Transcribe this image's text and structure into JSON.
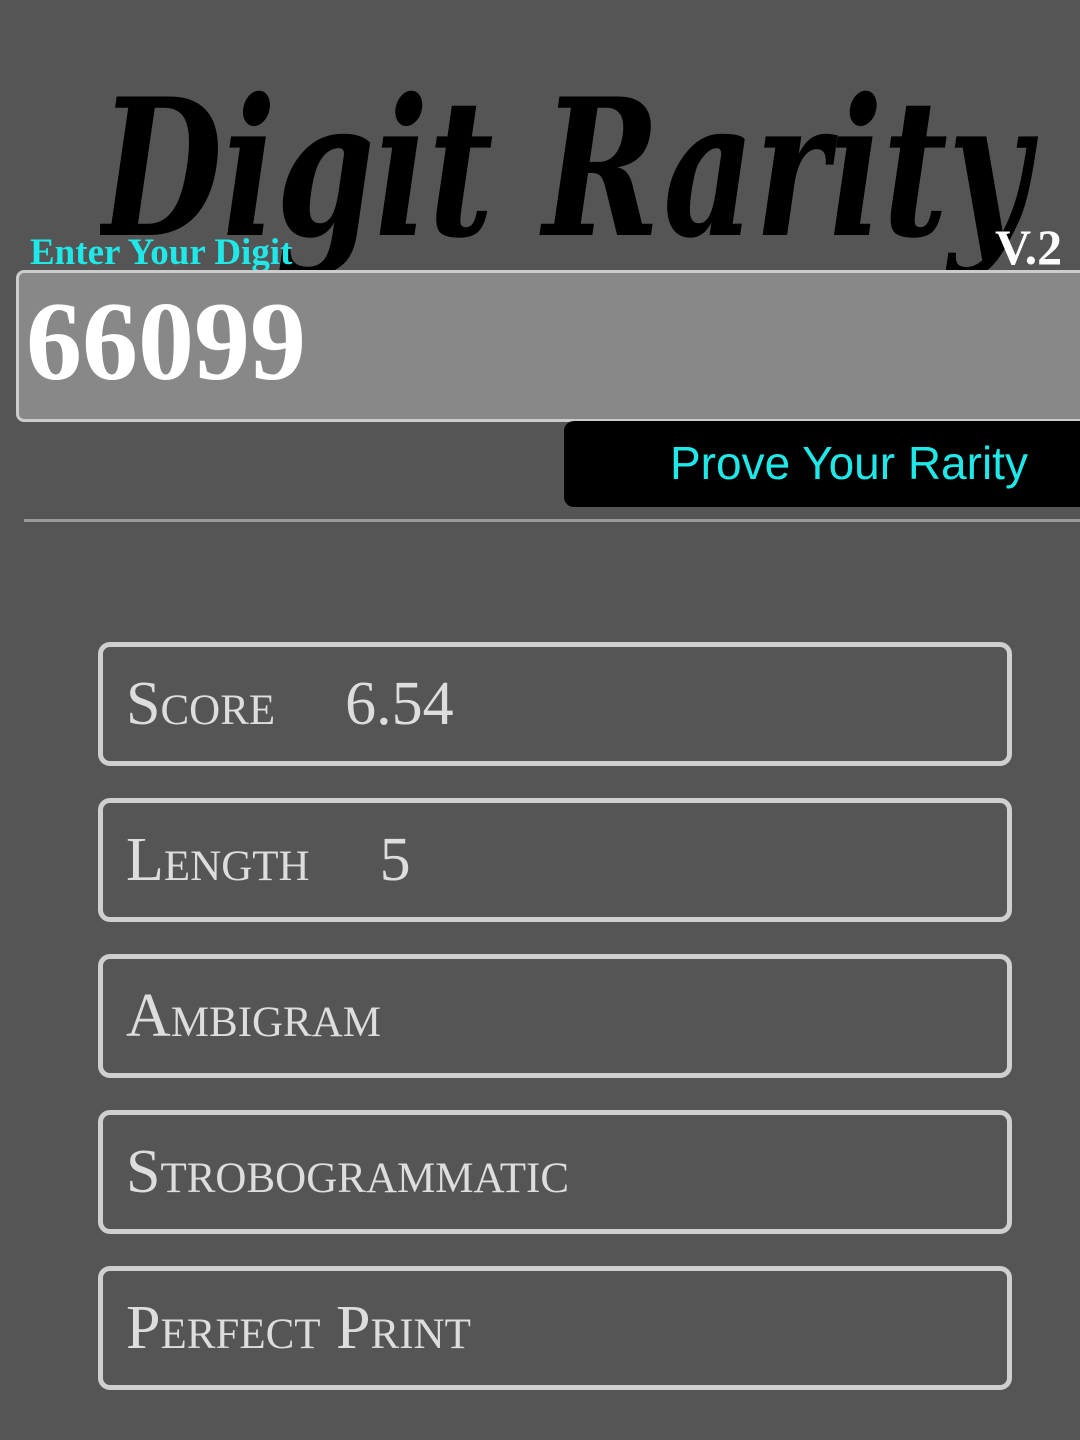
{
  "header": {
    "logo_title": "Digit Rarity",
    "version": "V.2"
  },
  "input": {
    "label": "Enter Your Digit",
    "value": "66099"
  },
  "button": {
    "label": "Prove Your Rarity"
  },
  "results": [
    {
      "label": "Score",
      "value": "6.54"
    },
    {
      "label": "Length",
      "value": "5"
    },
    {
      "label": "Ambigram",
      "value": ""
    },
    {
      "label": "Strobogrammatic",
      "value": ""
    },
    {
      "label": "Perfect Print",
      "value": ""
    }
  ],
  "colors": {
    "background": "#555555",
    "accent": "#1ee8e8",
    "input_bg": "#888888",
    "button_bg": "#000000",
    "box_border": "#cfcfcf"
  }
}
